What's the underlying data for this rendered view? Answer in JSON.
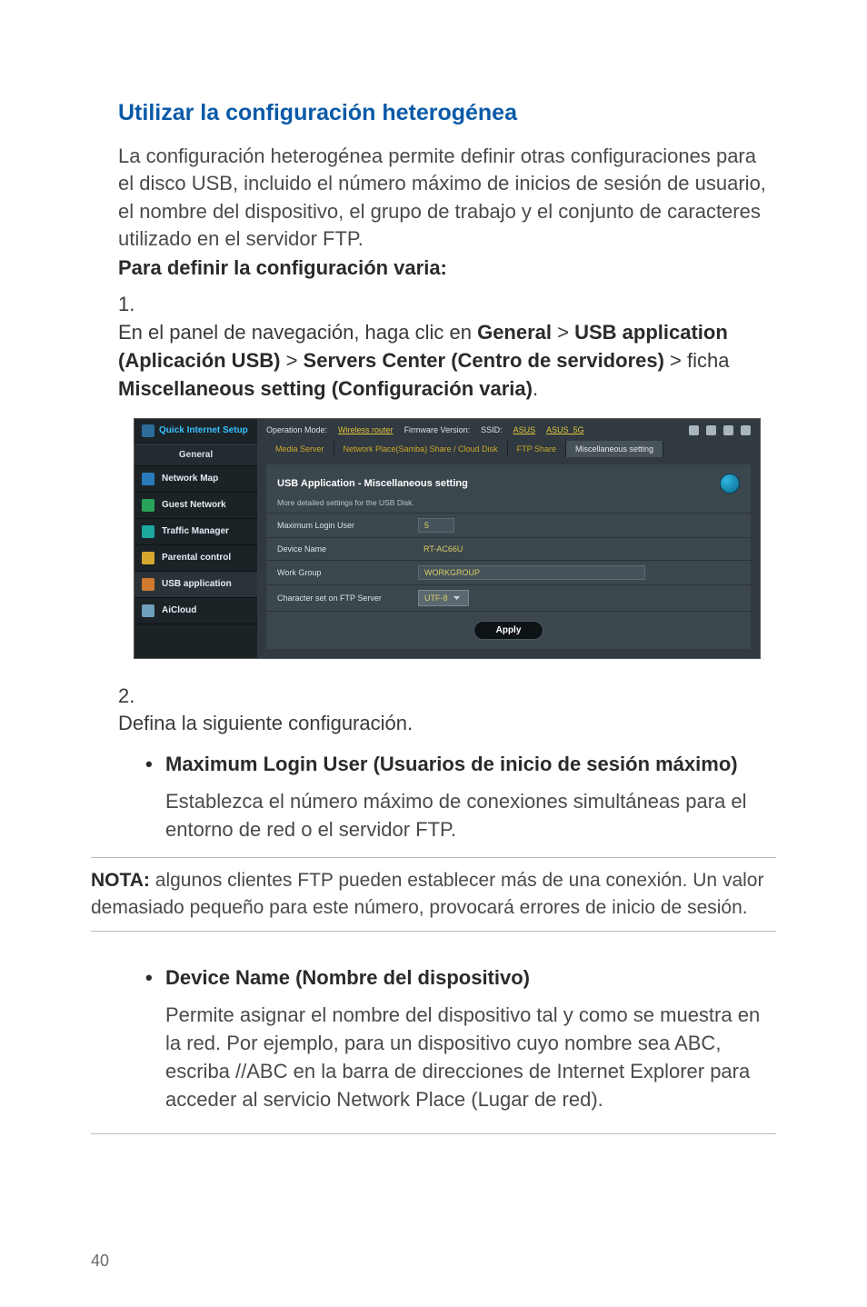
{
  "heading": "Utilizar la configuración heterogénea",
  "intro": "La configuración heterogénea permite definir otras configuraciones para el disco USB, incluido el número máximo de inicios de sesión de usuario, el nombre del dispositivo, el grupo de trabajo y el conjunto de caracteres utilizado en el servidor FTP.",
  "define_heading": "Para definir la configuración varia:",
  "step1": {
    "num": "1.",
    "pre": "En el panel de navegación, haga clic en ",
    "b1": "General",
    "gt1": " > ",
    "b2": "USB application (Aplicación USB)",
    "gt2": " > ",
    "b3": "Servers Center (Centro de servidores)",
    "gt3": " > ficha ",
    "b4": "Miscellaneous setting (Configuración varia)",
    "post": "."
  },
  "screenshot": {
    "sidebar": {
      "qis": "Quick Internet Setup",
      "cat": "General",
      "items": [
        {
          "label": "Network Map"
        },
        {
          "label": "Guest Network"
        },
        {
          "label": "Traffic Manager"
        },
        {
          "label": "Parental control"
        },
        {
          "label": "USB application"
        },
        {
          "label": "AiCloud"
        }
      ]
    },
    "topbar": {
      "opmode_label": "Operation Mode:",
      "opmode_value": "Wireless router",
      "fw_label": "Firmware Version:",
      "ssid_label": "SSID:",
      "ssid1": "ASUS",
      "ssid2": "ASUS_5G"
    },
    "tabs": [
      "Media Server",
      "Network Place(Samba) Share / Cloud Disk",
      "FTP Share",
      "Miscellaneous setting"
    ],
    "panel": {
      "title": "USB Application - Miscellaneous setting",
      "subtitle": "More detailed settings for the USB Disk.",
      "fields": {
        "max_login_label": "Maximum Login User",
        "max_login_value": "5",
        "device_name_label": "Device Name",
        "device_name_value": "RT-AC66U",
        "workgroup_label": "Work Group",
        "workgroup_value": "WORKGROUP",
        "charset_label": "Character set on FTP Server",
        "charset_value": "UTF-8"
      },
      "apply": "Apply"
    }
  },
  "step2": {
    "num": "2.",
    "text": "Defina la siguiente configuración."
  },
  "bullet1_title": "Maximum Login User (Usuarios de inicio de sesión máximo)",
  "bullet1_body": "Establezca el número máximo de conexiones simultáneas para el entorno de red o el servidor FTP.",
  "note_label": "NOTA:",
  "note_body": " algunos clientes FTP pueden establecer más de una conexión. Un valor demasiado pequeño para este número, provocará errores de inicio de sesión.",
  "bullet2_title": "Device Name (Nombre del dispositivo)",
  "bullet2_body": "Permite asignar el nombre del dispositivo tal y como se muestra en la red. Por ejemplo, para un dispositivo cuyo nombre sea ABC, escriba //ABC en la barra de direcciones de Internet Explorer para acceder al servicio Network Place (Lugar de red).",
  "page_number": "40"
}
